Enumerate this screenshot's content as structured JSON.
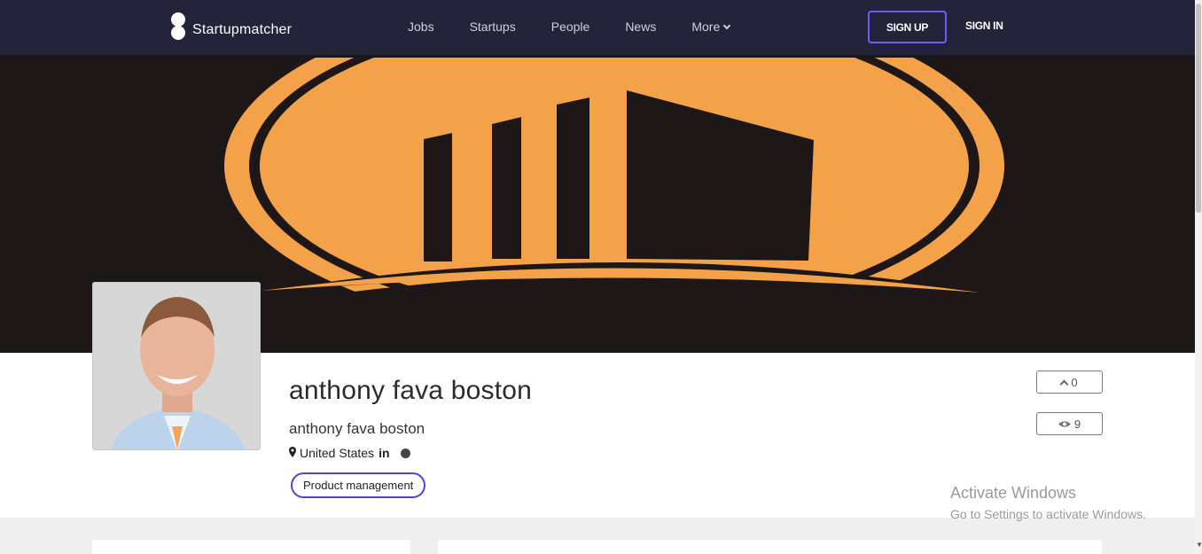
{
  "brand": {
    "name": "Startupmatcher"
  },
  "nav": {
    "links": [
      "Jobs",
      "Startups",
      "People",
      "News",
      "More"
    ],
    "signup": "SIGN UP",
    "signin": "SIGN IN"
  },
  "profile": {
    "title": "anthony fava boston",
    "subtitle": "anthony fava boston",
    "location": "United States",
    "linkedin": "in",
    "tags": [
      "Product management"
    ],
    "upvotes": "0",
    "views": "9"
  },
  "watermark": {
    "title": "Activate Windows",
    "subtitle": "Go to Settings to activate Windows."
  },
  "colors": {
    "nav_bg": "#23233a",
    "accent": "#5b3fd3",
    "banner_orange": "#f4a24a",
    "banner_bg": "#1d1717"
  }
}
